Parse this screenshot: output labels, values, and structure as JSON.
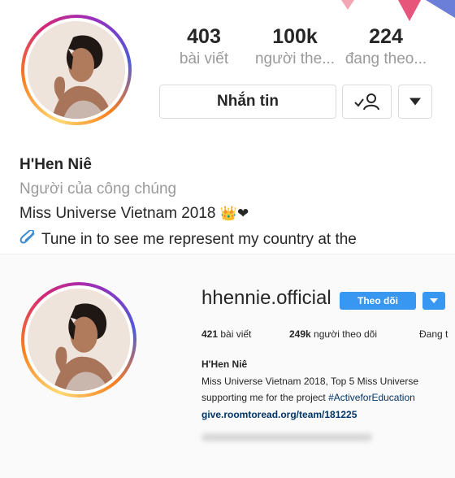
{
  "mobile": {
    "stats": [
      {
        "value": "403",
        "label": "bài viết"
      },
      {
        "value": "100k",
        "label": "người the..."
      },
      {
        "value": "224",
        "label": "đang theo..."
      }
    ],
    "message_button": "Nhắn tin",
    "following_icon": "user-check-icon",
    "more_icon": "caret-down-icon",
    "name": "H'Hen Niê",
    "category": "Người của công chúng",
    "bio_line1": "Miss Universe Vietnam 2018",
    "bio_emoji_crown": "👑",
    "bio_emoji_heart": "❤",
    "link_icon": "paperclip-icon",
    "bio_line2": "Tune in to see me represent my country at the"
  },
  "desktop": {
    "username": "hhennie.official",
    "follow_button": "Theo dõi",
    "posts_value": "421",
    "posts_label": " bài viết",
    "followers_value": "249k",
    "followers_label": " người theo dõi",
    "following_label": "Đang t",
    "name": "H'Hen Niê",
    "bio_line1": "Miss Universe Vietnam 2018, Top 5 Miss Universe",
    "bio_line2_prefix": "supporting me for the project ",
    "bio_hashtag": "#ActiveforEducation",
    "link": "give.roomtoread.org/team/181225"
  },
  "colors": {
    "accent": "#3897f0",
    "text": "#262626",
    "muted": "#9a9a9a",
    "link": "#003569"
  }
}
